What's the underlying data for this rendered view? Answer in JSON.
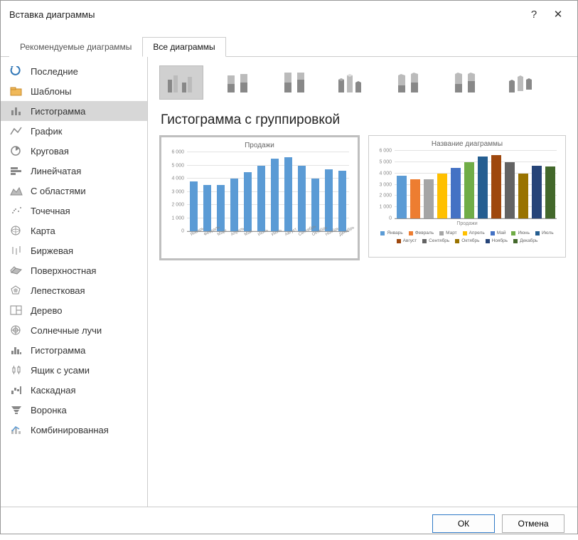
{
  "window": {
    "title": "Вставка диаграммы",
    "help": "?",
    "close": "✕"
  },
  "tabs": {
    "recommended": "Рекомендуемые диаграммы",
    "all": "Все диаграммы"
  },
  "categories": [
    {
      "key": "recent",
      "label": "Последние",
      "icon": "recent"
    },
    {
      "key": "templates",
      "label": "Шаблоны",
      "icon": "folder"
    },
    {
      "key": "column",
      "label": "Гистограмма",
      "icon": "bars",
      "selected": true
    },
    {
      "key": "line",
      "label": "График",
      "icon": "line"
    },
    {
      "key": "pie",
      "label": "Круговая",
      "icon": "pie"
    },
    {
      "key": "bar",
      "label": "Линейчатая",
      "icon": "hbars"
    },
    {
      "key": "area",
      "label": "С областями",
      "icon": "area"
    },
    {
      "key": "scatter",
      "label": "Точечная",
      "icon": "scatter"
    },
    {
      "key": "map",
      "label": "Карта",
      "icon": "map"
    },
    {
      "key": "stock",
      "label": "Биржевая",
      "icon": "stock"
    },
    {
      "key": "surface",
      "label": "Поверхностная",
      "icon": "surface"
    },
    {
      "key": "radar",
      "label": "Лепестковая",
      "icon": "radar"
    },
    {
      "key": "treemap",
      "label": "Дерево",
      "icon": "treemap"
    },
    {
      "key": "sunburst",
      "label": "Солнечные лучи",
      "icon": "sunburst"
    },
    {
      "key": "histogram",
      "label": "Гистограмма",
      "icon": "histogram"
    },
    {
      "key": "box",
      "label": "Ящик с усами",
      "icon": "box"
    },
    {
      "key": "waterfall",
      "label": "Каскадная",
      "icon": "waterfall"
    },
    {
      "key": "funnel",
      "label": "Воронка",
      "icon": "funnel"
    },
    {
      "key": "combo",
      "label": "Комбинированная",
      "icon": "combo"
    }
  ],
  "subtypes": [
    {
      "key": "clustered",
      "selected": true
    },
    {
      "key": "stacked"
    },
    {
      "key": "stacked100"
    },
    {
      "key": "clustered3d"
    },
    {
      "key": "stacked3d"
    },
    {
      "key": "stacked1003d"
    },
    {
      "key": "column3d"
    }
  ],
  "subtype_title": "Гистограмма с группировкой",
  "preview1": {
    "title": "Продажи",
    "ymax": 6000,
    "yticks": [
      "0",
      "1 000",
      "2 000",
      "3 000",
      "4 000",
      "5 000",
      "6 000"
    ]
  },
  "preview2": {
    "title": "Название диаграммы",
    "ymax": 6000,
    "yticks": [
      "0",
      "1 000",
      "2 000",
      "3 000",
      "4 000",
      "5 000",
      "6 000"
    ],
    "xcat": "Продажи"
  },
  "chart_data": {
    "type": "bar",
    "categories": [
      "Январь",
      "Февраль",
      "Март",
      "Апрель",
      "Май",
      "Июнь",
      "Июль",
      "Август",
      "Сентябрь",
      "Октябрь",
      "Ноябрь",
      "Декабрь"
    ],
    "values": [
      3800,
      3500,
      3500,
      4000,
      4500,
      5000,
      5500,
      5600,
      5000,
      4000,
      4700,
      4600
    ],
    "colors": [
      "#5b9bd5",
      "#ed7d31",
      "#a5a5a5",
      "#ffc000",
      "#4472c4",
      "#70ad47",
      "#255e91",
      "#9e480e",
      "#636363",
      "#997300",
      "#264478",
      "#43682b"
    ],
    "title": "Продажи",
    "ylim": [
      0,
      6000
    ]
  },
  "footer": {
    "ok": "ОК",
    "cancel": "Отмена"
  }
}
